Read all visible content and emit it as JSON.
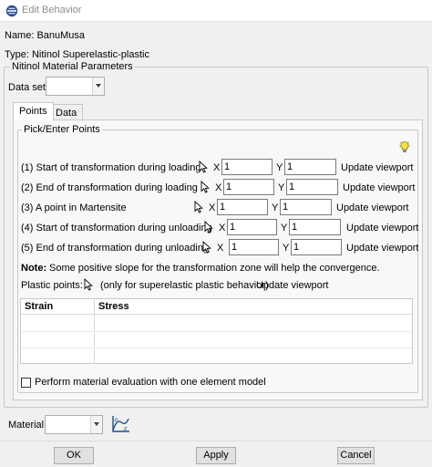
{
  "window": {
    "title": "Edit Behavior"
  },
  "header": {
    "name_label": "Name: BanuMusa",
    "type_label": "Type: Nitinol Superelastic-plastic"
  },
  "params": {
    "group_title": "Nitinol Material Parameters",
    "dataset_label": "Data set:",
    "dataset_value": ""
  },
  "tabs": [
    {
      "label": "Points",
      "active": true
    },
    {
      "label": "Data",
      "active": false
    }
  ],
  "points": {
    "group_title": "Pick/Enter Points",
    "x_label": "X",
    "y_label": "Y",
    "update_label": "Update viewport",
    "rows": [
      {
        "label": "(1) Start of transformation during loading",
        "x": "1",
        "y": "1"
      },
      {
        "label": "(2) End of transformation during loading",
        "x": "1",
        "y": "1"
      },
      {
        "label": "(3) A point in Martensite",
        "x": "1",
        "y": "1"
      },
      {
        "label": "(4) Start of transformation during unloading",
        "x": "1",
        "y": "1"
      },
      {
        "label": "(5) End of transformation during unloading",
        "x": "1",
        "y": "1"
      }
    ],
    "note_bold": "Note:",
    "note_text": "Some positive slope for the transformation zone will help the convergence.",
    "plastic_label": "Plastic points:",
    "plastic_hint": "(only for superelastic plastic behavior)",
    "plastic_update": "Update viewport"
  },
  "table": {
    "headers": [
      "Strain",
      "Stress"
    ],
    "rows": []
  },
  "evaluation": {
    "label": "Perform material evaluation with one element model",
    "checked": false
  },
  "material": {
    "label": "Material:",
    "value": ""
  },
  "buttons": {
    "ok": "OK",
    "apply": "Apply",
    "cancel": "Cancel"
  },
  "icons": {
    "app": "abaqus-app-icon",
    "hint": "lightbulb-icon",
    "pick": "pick-cursor-icon",
    "material_plot": "material-plot-icon"
  }
}
